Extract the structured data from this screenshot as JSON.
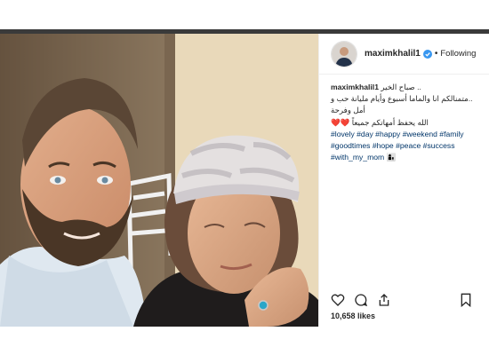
{
  "post": {
    "username": "maximkhalil1",
    "follow_label": "Following",
    "dot": "•",
    "caption_user": "maximkhalil1",
    "caption_lines": [
      "صباح الخير ..",
      "..متمنالكم انا والماما أسبوع وأيام مليانة حب و أمل وفرحة",
      "الله يحفظ أمهاتكم جميعاً ❤️❤️"
    ],
    "hashtags_line1": "#lovely #day #happy #weekend #family",
    "hashtags_line2": "#goodtimes #hope #peace #success",
    "hashtags_line3": "#with_my_mom",
    "caption_emoji": "👩‍👦",
    "likes": "10,658 likes"
  },
  "icons": {
    "like": "heart-icon",
    "comment": "comment-icon",
    "share": "share-icon",
    "save": "bookmark-icon",
    "verified": "verified-badge-icon"
  },
  "colors": {
    "link": "#003569",
    "verified": "#3897f0",
    "text": "#262626"
  }
}
